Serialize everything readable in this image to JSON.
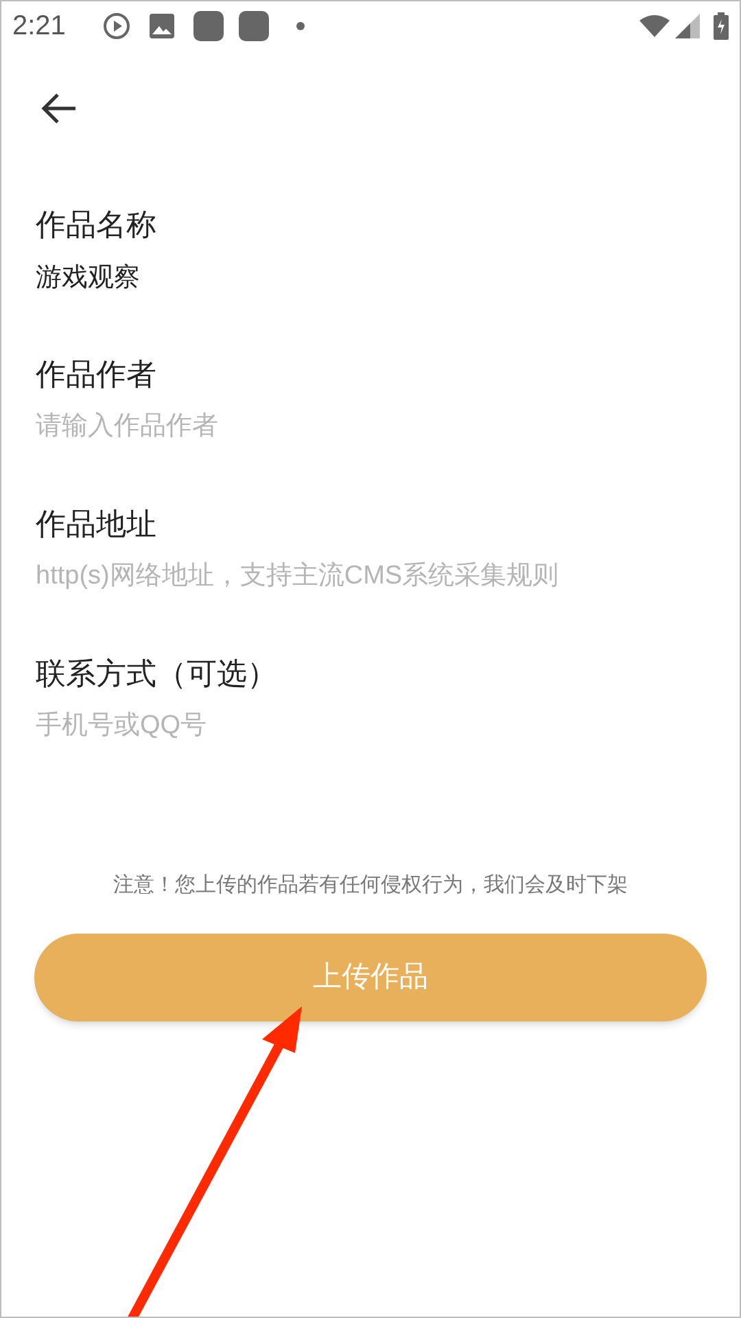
{
  "status_bar": {
    "time": "2:21"
  },
  "fields": [
    {
      "label": "作品名称",
      "value": "游戏观察"
    },
    {
      "label": "作品作者",
      "placeholder": "请输入作品作者"
    },
    {
      "label": "作品地址",
      "placeholder": "http(s)网络地址，支持主流CMS系统采集规则"
    },
    {
      "label": "联系方式（可选）",
      "placeholder": "手机号或QQ号"
    }
  ],
  "notice": "注意！您上传的作品若有任何侵权行为，我们会及时下架",
  "submit_button": "上传作品"
}
